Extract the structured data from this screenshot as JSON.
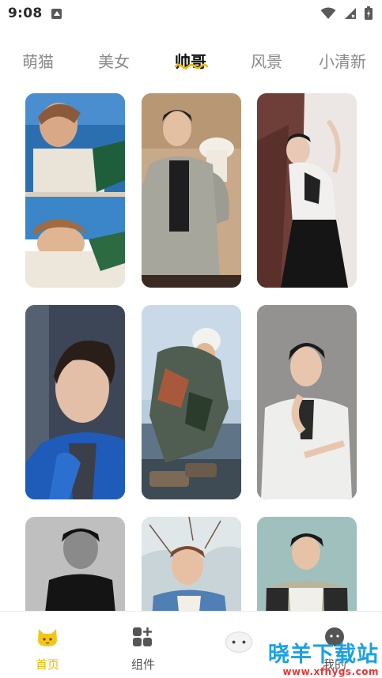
{
  "status_bar": {
    "time": "9:08",
    "icons": [
      "notification-a-icon",
      "wifi-icon",
      "signal-icon",
      "battery-icon"
    ]
  },
  "tabs": [
    {
      "label": "萌猫",
      "active": false
    },
    {
      "label": "美女",
      "active": false
    },
    {
      "label": "帅哥",
      "active": true
    },
    {
      "label": "风景",
      "active": false
    },
    {
      "label": "小清新",
      "active": false
    }
  ],
  "grid": {
    "items": [
      {
        "name": "photo-1"
      },
      {
        "name": "photo-2"
      },
      {
        "name": "photo-3"
      },
      {
        "name": "photo-4"
      },
      {
        "name": "photo-5"
      },
      {
        "name": "photo-6"
      },
      {
        "name": "photo-7"
      },
      {
        "name": "photo-8"
      },
      {
        "name": "photo-9"
      }
    ]
  },
  "bottom_nav": {
    "items": [
      {
        "label": "首页",
        "icon": "cat-icon",
        "active": true
      },
      {
        "label": "组件",
        "icon": "widgets-icon",
        "active": false
      },
      {
        "label": "",
        "icon": "sheep-icon",
        "active": false
      },
      {
        "label": "我的",
        "icon": "profile-icon",
        "active": false
      }
    ]
  },
  "watermark": {
    "main": "晓羊下载站",
    "sub": "www.xfhygs.com"
  },
  "colors": {
    "accent": "#f5b800",
    "tab_active": "#111111",
    "tab_inactive": "#8a8a8a"
  }
}
